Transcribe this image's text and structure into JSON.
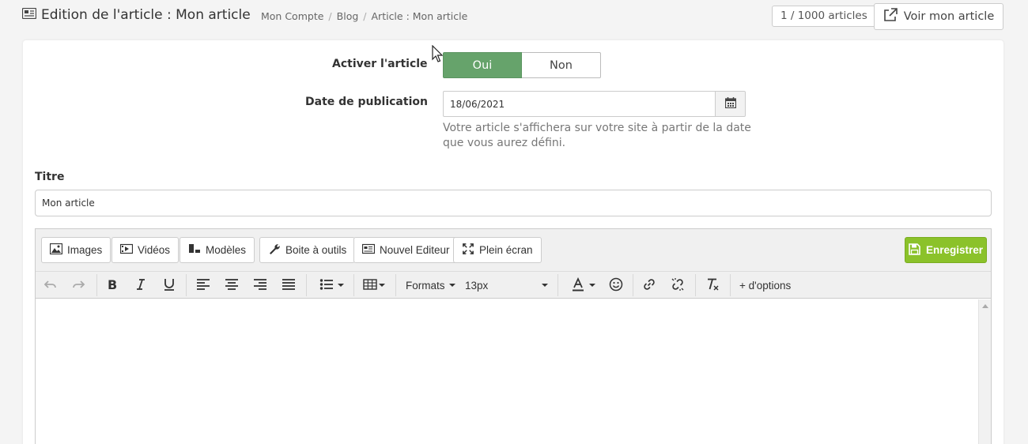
{
  "header": {
    "title": "Edition de l'article : Mon article",
    "breadcrumb": [
      "Mon Compte",
      "Blog",
      "Article : Mon article"
    ],
    "counter": "1 / 1000 articles",
    "view_button": "Voir mon article"
  },
  "form": {
    "activate_label": "Activer l'article",
    "toggle_yes": "Oui",
    "toggle_no": "Non",
    "date_label": "Date de publication",
    "date_value": "18/06/2021",
    "date_help": "Votre article s'affichera sur votre site à partir de la date que vous aurez défini.",
    "title_label": "Titre",
    "title_value": "Mon article"
  },
  "editor": {
    "top_buttons": {
      "images": "Images",
      "videos": "Vidéos",
      "models": "Modèles",
      "tools": "Boite à outils",
      "new_editor": "Nouvel Editeur",
      "fullscreen": "Plein écran"
    },
    "save_button": "Enregistrer",
    "toolbar": {
      "formats": "Formats",
      "font_size": "13px",
      "more_options": "+ d'options"
    }
  },
  "colors": {
    "toggle_active": "#66a36b",
    "save_green": "#8bc22a"
  }
}
